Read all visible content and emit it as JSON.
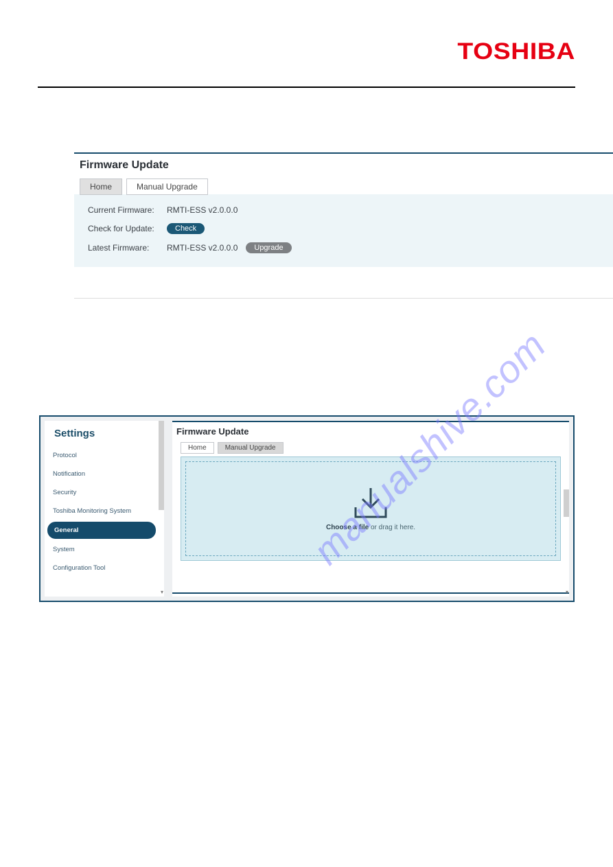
{
  "brand": "TOSHIBA",
  "watermark": "manualshive.com",
  "panel1": {
    "title": "Firmware Update",
    "tabs": {
      "home": "Home",
      "manual": "Manual Upgrade"
    },
    "rows": {
      "current_label": "Current Firmware:",
      "current_value": "RMTI-ESS v2.0.0.0",
      "check_label": "Check for Update:",
      "check_button": "Check",
      "latest_label": "Latest Firmware:",
      "latest_value": "RMTI-ESS v2.0.0.0",
      "upgrade_button": "Upgrade"
    }
  },
  "panel2": {
    "sidebar": {
      "title": "Settings",
      "items": [
        "Protocol",
        "Notification",
        "Security",
        "Toshiba Monitoring System",
        "General",
        "System",
        "Configuration Tool"
      ],
      "active_index": 4
    },
    "main": {
      "title": "Firmware Update",
      "tabs": {
        "home": "Home",
        "manual": "Manual Upgrade"
      },
      "dropzone_strong": "Choose a file",
      "dropzone_rest": " or drag it here."
    }
  }
}
